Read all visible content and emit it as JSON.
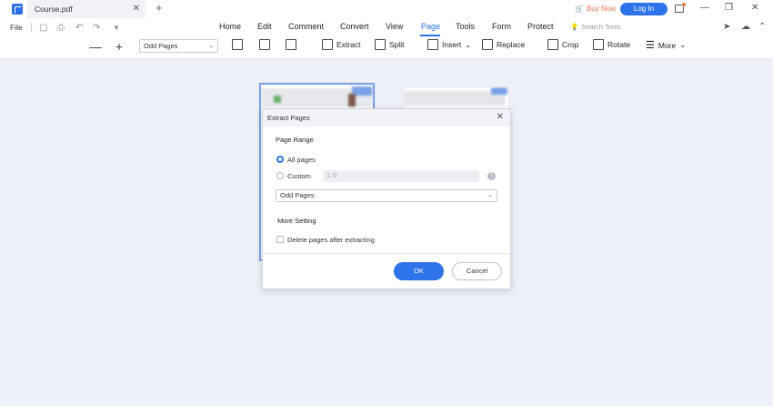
{
  "titlebar": {
    "tab_title": "Course.pdf",
    "buy_now": "Buy Now",
    "login": "Log In"
  },
  "menubar": {
    "file": "File",
    "tabs": [
      "Home",
      "Edit",
      "Comment",
      "Convert",
      "View",
      "Page",
      "Tools",
      "Form",
      "Protect"
    ],
    "active_tab": "Page",
    "search_placeholder": "Search Tools"
  },
  "toolbar": {
    "page_filter": "Odd Pages",
    "extract": "Extract",
    "split": "Split",
    "insert": "Insert",
    "replace": "Replace",
    "crop": "Crop",
    "rotate": "Rotate",
    "more": "More"
  },
  "dialog": {
    "title": "Extract Pages",
    "page_range_label": "Page Range",
    "all_pages": "All pages",
    "custom": "Custom",
    "custom_placeholder": "1 /2",
    "filter_value": "Odd Pages",
    "more_setting_label": "More Setting",
    "delete_after": "Delete pages after extracting",
    "ok": "OK",
    "cancel": "Cancel"
  },
  "colors": {
    "accent": "#2f73ea",
    "buy_now": "#e8734a",
    "canvas_bg": "#eef1f8"
  }
}
